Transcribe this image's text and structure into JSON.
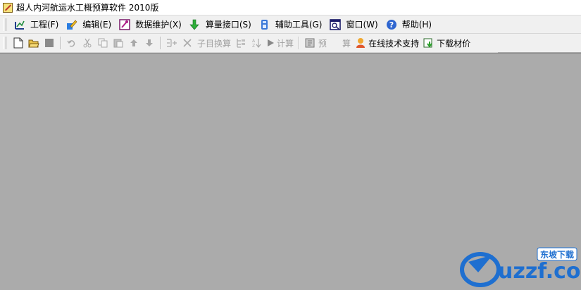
{
  "window": {
    "title": "超人内河航运水工概预算软件 2010版"
  },
  "menu": [
    {
      "label": "工程(F)",
      "icon": "project-icon"
    },
    {
      "label": "编辑(E)",
      "icon": "edit-icon"
    },
    {
      "label": "数据维护(X)",
      "icon": "data-maintenance-icon"
    },
    {
      "label": "算量接口(S)",
      "icon": "quantity-interface-icon"
    },
    {
      "label": "辅助工具(G)",
      "icon": "tools-icon"
    },
    {
      "label": "窗口(W)",
      "icon": "window-icon"
    },
    {
      "label": "帮助(H)",
      "icon": "help-icon"
    }
  ],
  "toolbar": {
    "subitem_calc": "子目换算",
    "calculate": "计算",
    "budget_pre": "预",
    "budget_calc": "算",
    "online_support": "在线技术支持",
    "download_prices": "下载材价"
  },
  "watermark": {
    "site": "uzzf.com",
    "tag": "东坡下载"
  }
}
